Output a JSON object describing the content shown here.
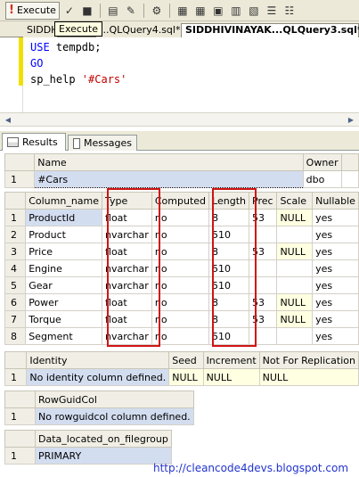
{
  "toolbar": {
    "execute_label": "Execute",
    "tooltip": "Execute"
  },
  "doc_tabs": [
    {
      "label": "SIDDH"
    },
    {
      "label": "...QLQuery4.sql*"
    },
    {
      "label": "SIDDHIVINAYAK...QLQuery3.sql*"
    }
  ],
  "editor": {
    "line1_kw": "USE",
    "line1_rest": " tempdb;",
    "line2_kw": "GO",
    "line3_kw": "sp_help",
    "line3_str": " '#Cars'"
  },
  "result_tabs": {
    "results": "Results",
    "messages": "Messages"
  },
  "grid1": {
    "columns": [
      "Name",
      "Owner"
    ],
    "rows": [
      {
        "n": "1",
        "name": "#Cars",
        "owner": "dbo"
      }
    ]
  },
  "grid2": {
    "columns": [
      "Column_name",
      "Type",
      "Computed",
      "Length",
      "Prec",
      "Scale",
      "Nullable"
    ],
    "rows": [
      {
        "n": "1",
        "name": "ProductId",
        "type": "float",
        "computed": "no",
        "length": "8",
        "prec": "53",
        "scale": "NULL",
        "nullable": "yes"
      },
      {
        "n": "2",
        "name": "Product",
        "type": "nvarchar",
        "computed": "no",
        "length": "510",
        "prec": "",
        "scale": "",
        "nullable": "yes"
      },
      {
        "n": "3",
        "name": "Price",
        "type": "float",
        "computed": "no",
        "length": "8",
        "prec": "53",
        "scale": "NULL",
        "nullable": "yes"
      },
      {
        "n": "4",
        "name": "Engine",
        "type": "nvarchar",
        "computed": "no",
        "length": "510",
        "prec": "",
        "scale": "",
        "nullable": "yes"
      },
      {
        "n": "5",
        "name": "Gear",
        "type": "nvarchar",
        "computed": "no",
        "length": "510",
        "prec": "",
        "scale": "",
        "nullable": "yes"
      },
      {
        "n": "6",
        "name": "Power",
        "type": "float",
        "computed": "no",
        "length": "8",
        "prec": "53",
        "scale": "NULL",
        "nullable": "yes"
      },
      {
        "n": "7",
        "name": "Torque",
        "type": "float",
        "computed": "no",
        "length": "8",
        "prec": "53",
        "scale": "NULL",
        "nullable": "yes"
      },
      {
        "n": "8",
        "name": "Segment",
        "type": "nvarchar",
        "computed": "no",
        "length": "510",
        "prec": "",
        "scale": "",
        "nullable": "yes"
      }
    ]
  },
  "grid3": {
    "columns": [
      "Identity",
      "Seed",
      "Increment",
      "Not For Replication"
    ],
    "rows": [
      {
        "n": "1",
        "identity": "No identity column defined.",
        "seed": "NULL",
        "increment": "NULL",
        "nfr": "NULL"
      }
    ]
  },
  "grid4": {
    "columns": [
      "RowGuidCol"
    ],
    "rows": [
      {
        "n": "1",
        "value": "No rowguidcol column defined."
      }
    ]
  },
  "grid5": {
    "columns": [
      "Data_located_on_filegroup"
    ],
    "rows": [
      {
        "n": "1",
        "value": "PRIMARY"
      }
    ]
  },
  "watermark": "http://cleancode4devs.blogspot.com"
}
